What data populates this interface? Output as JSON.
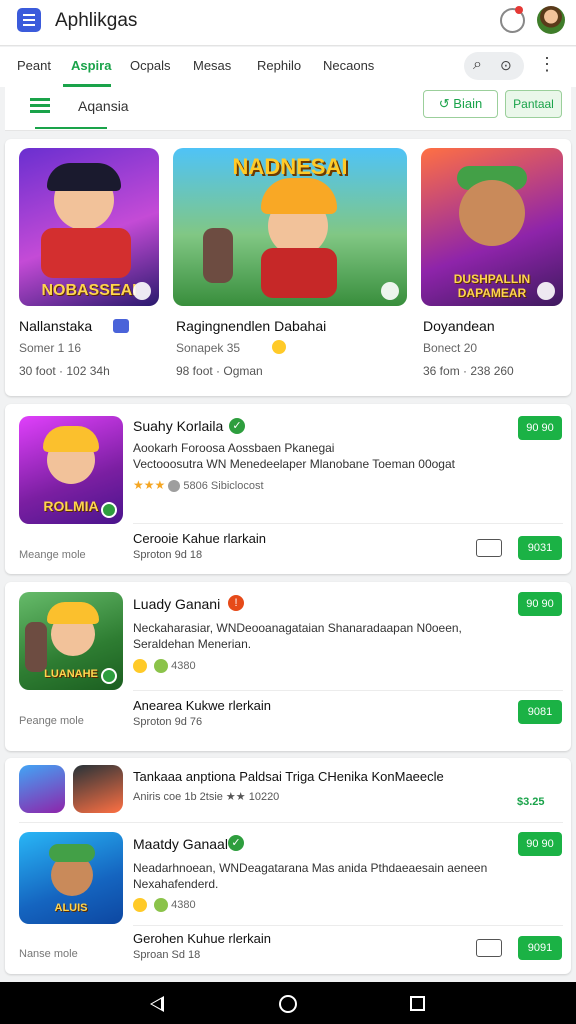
{
  "app": {
    "title": "Aphlikgas",
    "logo_color": "#3b5bdb"
  },
  "header_icons": [
    "app-logo-icon",
    "notification-bell-icon",
    "avatar"
  ],
  "tabs": [
    "Peant",
    "Aspira",
    "Ocpals",
    "Mesas",
    "Rephilo",
    "Necaons"
  ],
  "active_tab": "Aspira",
  "accent_color": "#1aa34a",
  "toolbar": {
    "label": "Aqansia",
    "outline_button": "Biain",
    "soft_button": "Pantaal"
  },
  "featured": [
    {
      "name": "Nallanstaka",
      "sub": "Somer 1 16",
      "meta": "30 foot · 102 34h",
      "art_label": "NOBASSEAI"
    },
    {
      "name": "Ragingnendlen Dabahai",
      "sub": "Sonapek 35",
      "meta": "98 foot · Ogman",
      "art_label": "NADNESAI"
    },
    {
      "name": "Doyandean",
      "sub": "Bonect 20",
      "meta": "36 fom · 238 260",
      "art_label": "DUSHPALLIN DAPAMEAR"
    }
  ],
  "list": [
    {
      "title": "Suahy Korlaila",
      "badge_color": "#2e9e3e",
      "desc1": "Aookarh Foroosa Aossbaen Pkanegai",
      "desc2": "Vectooosutra WN Menedeelaper Mlanobane Toeman 00ogat",
      "stars": "★★★",
      "rating": "5806 Sibiclocost",
      "price": "90 90",
      "art_label": "ROLMIA",
      "note": "Meange mole",
      "sub_title": "Cerooie Kahue rlarkain",
      "sub_meta": "Sproton 9d 18",
      "sub_price": "9031"
    },
    {
      "title": "Luady Ganani",
      "badge_color": "#e64a19",
      "desc1": "Neckaharasiar, WNDeooanagataian Shanaradaapan N0oeen,",
      "desc2": "Seraldehan Menerian.",
      "stars": "",
      "rating": "4380",
      "price": "90 90",
      "art_label": "LUANAHE",
      "note": "Peange mole",
      "sub_title": "Anearea Kukwe rlerkain",
      "sub_meta": "Sproton 9d 76",
      "sub_price": "9081"
    },
    {
      "bundle_title": "Tankaaa anptiona Paldsai Triga CHenika KonMaeecle",
      "bundle_meta": "Aniris coe 1b 2tsie ★★ 10220",
      "bundle_price": "$3.25",
      "title": "Maatdy Ganaal",
      "badge_color": "#2e9e3e",
      "desc1": "Neadarhnoean, WNDeagatarana Mas anida Pthdaeaesain aeneen",
      "desc2": "Nexahafenderd.",
      "stars": "",
      "rating": "4380",
      "price": "90 90",
      "art_label": "ALUIS",
      "note": "Nanse mole",
      "sub_title": "Gerohen Kuhue rlerkain",
      "sub_meta": "Sproan Sd 18",
      "sub_price": "9091"
    }
  ],
  "status_colors": {
    "price_pill": "#1bb245"
  }
}
